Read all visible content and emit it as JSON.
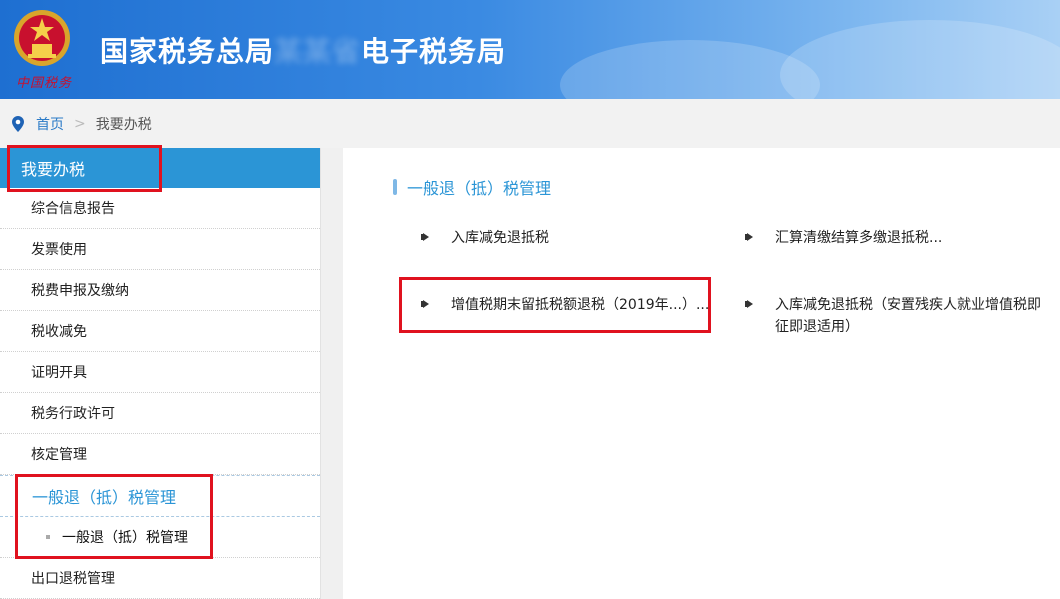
{
  "header": {
    "emblem_text": "中国税务",
    "title_prefix": "国家税务总局",
    "title_blurred": "某某省",
    "title_suffix": "电子税务局"
  },
  "breadcrumb": {
    "home": "首页",
    "separator": ">",
    "current": "我要办税"
  },
  "sidebar": {
    "heading": "我要办税",
    "items": [
      {
        "label": "综合信息报告"
      },
      {
        "label": "发票使用"
      },
      {
        "label": "税费申报及缴纳"
      },
      {
        "label": "税收减免"
      },
      {
        "label": "证明开具"
      },
      {
        "label": "税务行政许可"
      },
      {
        "label": "核定管理"
      }
    ],
    "active_item": "一般退（抵）税管理",
    "sub_item": "一般退（抵）税管理",
    "after_items": [
      {
        "label": "出口退税管理"
      }
    ]
  },
  "main": {
    "section_title": "一般退（抵）税管理",
    "links": [
      {
        "label": "入库减免退抵税"
      },
      {
        "label": "汇算清缴结算多缴退抵税..."
      },
      {
        "label": "增值税期末留抵税额退税（2019年...）..."
      },
      {
        "label": "入库减免退抵税（安置残疾人就业增值税即征即退适用）"
      }
    ]
  },
  "colors": {
    "accent": "#2b95d6",
    "highlight_box": "#e0121f",
    "header_start": "#1e6fd1"
  }
}
